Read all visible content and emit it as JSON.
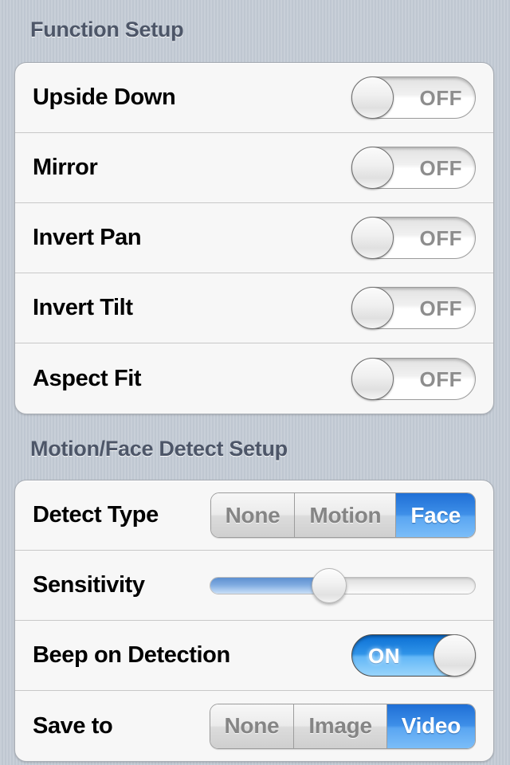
{
  "theme": {
    "background": "#c3cad4",
    "panel_background": "#f7f7f7",
    "header_text": "#4d5668",
    "accent_blue": "#2f93e8",
    "segment_selected_blue": "#3e8fe8",
    "muted_text": "#858585"
  },
  "sections": [
    {
      "id": "function-setup",
      "title": "Function Setup",
      "rows": [
        {
          "label": "Upside Down",
          "control": "toggle",
          "value": "OFF",
          "on": false
        },
        {
          "label": "Mirror",
          "control": "toggle",
          "value": "OFF",
          "on": false
        },
        {
          "label": "Invert Pan",
          "control": "toggle",
          "value": "OFF",
          "on": false
        },
        {
          "label": "Invert Tilt",
          "control": "toggle",
          "value": "OFF",
          "on": false
        },
        {
          "label": "Aspect Fit",
          "control": "toggle",
          "value": "OFF",
          "on": false
        }
      ]
    },
    {
      "id": "motion-face-detect-setup",
      "title": "Motion/Face Detect Setup",
      "rows": [
        {
          "label": "Detect Type",
          "control": "segmented",
          "options": [
            "None",
            "Motion",
            "Face"
          ],
          "selected": "Face",
          "selected_index": 2
        },
        {
          "label": "Sensitivity",
          "control": "slider",
          "percent": 45,
          "min": 0,
          "max": 100
        },
        {
          "label": "Beep on Detection",
          "control": "toggle",
          "value": "ON",
          "on": true
        },
        {
          "label": "Save to",
          "control": "segmented",
          "options": [
            "None",
            "Image",
            "Video"
          ],
          "selected": "Video",
          "selected_index": 2
        }
      ]
    }
  ]
}
